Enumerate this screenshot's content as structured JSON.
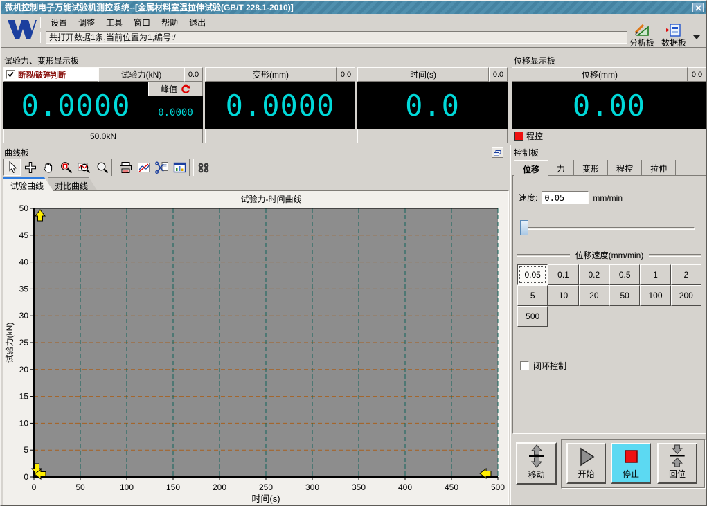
{
  "window": {
    "title": "微机控制电子万能试验机测控系统--[金属材料室温拉伸试验(GB/T 228.1-2010)]"
  },
  "menu": {
    "items": [
      "设置",
      "调整",
      "工具",
      "窗口",
      "帮助",
      "退出"
    ]
  },
  "toolbar": {
    "status_text": "共打开数据1条,当前位置为1,编号:/",
    "analysis_label": "分析板",
    "data_label": "数据板"
  },
  "display": {
    "left_group_title": "试验力、变形显示板",
    "right_group_title": "位移显示板",
    "force": {
      "judge_label": "断裂/破碎判断",
      "judge_checked": true,
      "header": "试验力(kN)",
      "mini_value": "0.0",
      "value": "0.0000",
      "peak_label": "峰值",
      "peak_value": "0.0000",
      "range_label": "50.0kN"
    },
    "deform": {
      "header": "变形(mm)",
      "mini_value": "0.0",
      "value": "0.0000"
    },
    "time": {
      "header": "时间(s)",
      "mini_value": "0.0",
      "value": "0.0"
    },
    "displacement": {
      "header": "位移(mm)",
      "mini_value": "0.0",
      "value": "0.00",
      "status_label": "程控"
    }
  },
  "curve_panel": {
    "title": "曲线板",
    "tabs": [
      "试验曲线",
      "对比曲线"
    ],
    "active_tab": "试验曲线"
  },
  "chart_data": {
    "type": "line",
    "title": "试验力-时间曲线",
    "xlabel": "时间(s)",
    "ylabel": "试验力(kN)",
    "xlim": [
      0,
      500
    ],
    "ylim": [
      0,
      50
    ],
    "x_ticks": [
      0,
      50,
      100,
      150,
      200,
      250,
      300,
      350,
      400,
      450,
      500
    ],
    "y_ticks": [
      0,
      5,
      10,
      15,
      20,
      25,
      30,
      35,
      40,
      45,
      50
    ],
    "series": [],
    "grid": "dashed",
    "plot_bg": "#8d8d8d",
    "grid_color_h": "#a8601f",
    "grid_color_v": "#11635a",
    "axis_marker_color": "#ffee00"
  },
  "control_panel": {
    "title": "控制板",
    "tabs": [
      "位移",
      "力",
      "变形",
      "程控",
      "拉伸"
    ],
    "active_tab": "位移",
    "speed_label": "速度:",
    "speed_value": "0.05",
    "speed_unit": "mm/min",
    "speed_group_title": "位移速度(mm/min)",
    "speed_options": [
      "0.05",
      "0.1",
      "0.2",
      "0.5",
      "1",
      "2",
      "5",
      "10",
      "20",
      "50",
      "100",
      "200",
      "500"
    ],
    "selected_speed": "0.05",
    "closed_loop_label": "闭环控制",
    "closed_loop_checked": false,
    "move_label": "移动",
    "start_label": "开始",
    "stop_label": "停止",
    "return_label": "回位"
  },
  "colors": {
    "titlebar": "#4a8aa8",
    "digit": "#00d9d9",
    "display_bg": "#000000",
    "stop_button_bg": "#5cd9f2",
    "alert_text": "#8c1713",
    "status_red": "#ee1111"
  }
}
